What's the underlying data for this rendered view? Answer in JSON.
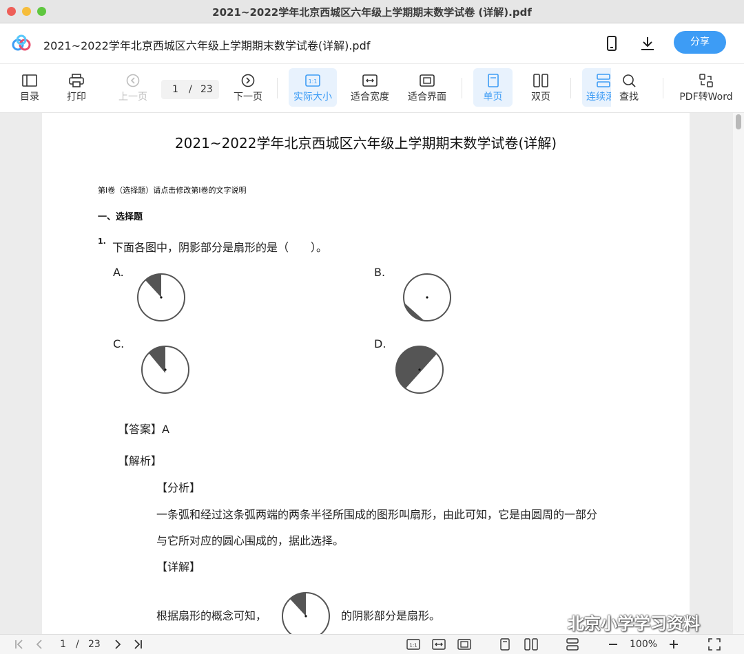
{
  "window": {
    "title": "2021~2022学年北京西城区六年级上学期期末数学试卷 (详解).pdf"
  },
  "appbar": {
    "doc_name": "2021~2022学年北京西城区六年级上学期期末数学试卷(详解).pdf",
    "share_label": "分享",
    "icons": [
      "phone-icon",
      "download-icon"
    ]
  },
  "toolbar": {
    "toc": "目录",
    "print": "打印",
    "prev": "上一页",
    "page_current": "1",
    "page_sep": "/",
    "page_total": "23",
    "next": "下一页",
    "actual_size": "实际大小",
    "fit_width": "适合宽度",
    "fit_page": "适合界面",
    "single": "单页",
    "double": "双页",
    "continuous": "连续滚",
    "find": "查找",
    "pdf_to_word": "PDF转Word",
    "accent_color": "#3d9cf5"
  },
  "document": {
    "title": "2021~2022学年北京西城区六年级上学期期末数学试卷(详解)",
    "section_note": "第Ⅰ卷（选择题）请点击修改第Ⅰ卷的文字说明",
    "section_heading": "一、选择题",
    "q_num": "1.",
    "q_text": "下面各图中，阴影部分是扇形的是（　　）。",
    "options": [
      "A.",
      "B.",
      "C.",
      "D."
    ],
    "answer": "【答案】A",
    "analysis": "【解析】",
    "fenxi": "【分析】",
    "explain_line1": "一条弧和经过这条弧两端的两条半径所围成的图形叫扇形，由此可知，它是由圆周的一部分",
    "explain_line2": "与它所对应的圆心围成的，据此选择。",
    "detail": "【详解】",
    "conclusion_left": "根据扇形的概念可知，",
    "conclusion_right": "的阴影部分是扇形。"
  },
  "bottombar": {
    "page_current": "1",
    "page_sep": "/",
    "page_total": "23",
    "zoom": "100%"
  },
  "watermark": {
    "text": "北京小学学习资料"
  }
}
